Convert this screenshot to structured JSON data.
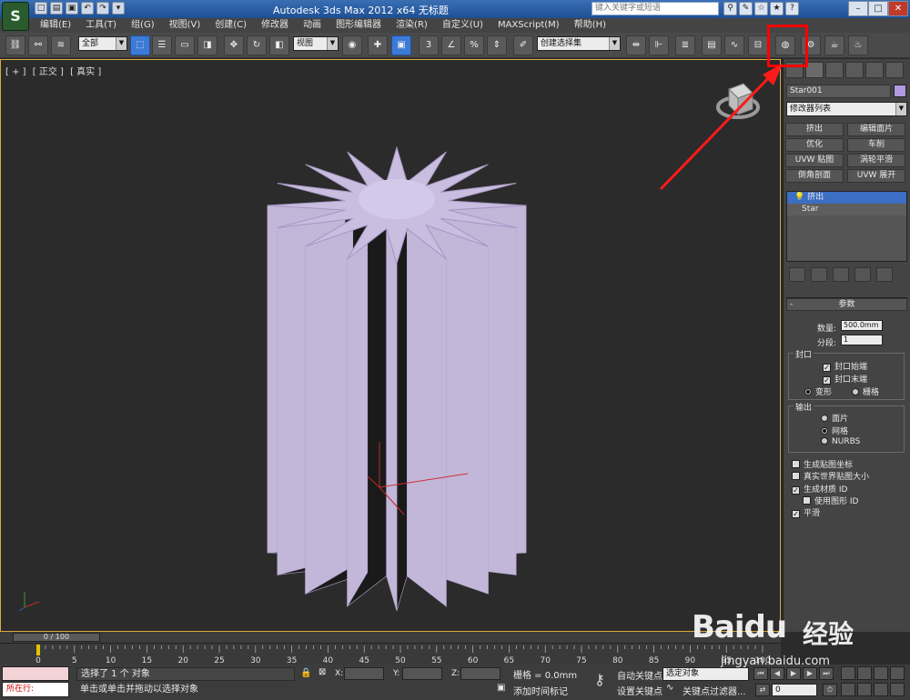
{
  "titlebar": {
    "app_logo": "S",
    "title": "Autodesk 3ds Max  2012 x64      无标题",
    "search_placeholder": "键入关键字或短语"
  },
  "menu": [
    "编辑(E)",
    "工具(T)",
    "组(G)",
    "视图(V)",
    "创建(C)",
    "修改器",
    "动画",
    "图形编辑器",
    "渲染(R)",
    "自定义(U)",
    "MAXScript(M)",
    "帮助(H)"
  ],
  "toolbar": {
    "filter_select": "全部",
    "view_select": "视图",
    "selection_set": "创建选择集",
    "icons": [
      "link-icon",
      "unlink-icon",
      "bind-icon",
      "select-icon",
      "select-by-name-icon",
      "rect-select-icon",
      "window-crossing-icon",
      "move-icon",
      "rotate-icon",
      "scale-icon",
      "pivot-icon",
      "manipulate-icon",
      "snap-3d-icon",
      "angle-snap-icon",
      "percent-snap-icon",
      "spinner-snap-icon",
      "edit-named-sel-icon",
      "mirror-icon",
      "align-icon",
      "layer-icon",
      "graphite-icon",
      "curve-editor-icon",
      "schematic-icon",
      "material-editor-icon",
      "render-setup-icon",
      "render-frame-icon",
      "render-icon"
    ]
  },
  "viewport": {
    "labels": [
      "[ + ]",
      "[ 正交 ]",
      "[ 真实 ]"
    ]
  },
  "command_panel": {
    "object_name": "Star001",
    "object_color": "#b29ae0",
    "modifier_list": "修改器列表",
    "modifier_buttons": [
      "挤出",
      "编辑面片",
      "优化",
      "车削",
      "UVW 贴图",
      "涡轮平滑",
      "倒角剖面",
      "UVW 展开"
    ],
    "stack": [
      {
        "label": "挤出",
        "selected": true
      },
      {
        "label": "Star",
        "selected": false
      }
    ],
    "params": {
      "title": "参数",
      "amount_label": "数量:",
      "amount_value": "500.0mm",
      "segments_label": "分段:",
      "segments_value": "1",
      "capping_title": "封口",
      "cap_start": "封口始端",
      "cap_end": "封口末端",
      "morph": "变形",
      "grid": "栅格",
      "output_title": "输出",
      "patch": "面片",
      "mesh": "网格",
      "nurbs": "NURBS",
      "gen_map_coords": "生成贴图坐标",
      "real_world_map": "真实世界贴图大小",
      "gen_mat_id": "生成材质 ID",
      "use_shape_id": "使用图形 ID",
      "smooth": "平滑"
    }
  },
  "timeline": {
    "slider": "0 / 100",
    "ticks": [
      "0",
      "5",
      "10",
      "15",
      "20",
      "25",
      "30",
      "35",
      "40",
      "45",
      "50",
      "55",
      "60",
      "65",
      "70",
      "75",
      "80",
      "85",
      "90",
      "95",
      "100"
    ]
  },
  "status": {
    "running": "所在行:",
    "selected_msg": "选择了 1 个 对象",
    "prompt": "单击或单击并拖动以选择对象",
    "x_label": "X:",
    "y_label": "Y:",
    "z_label": "Z:",
    "grid": "栅格 = 0.0mm",
    "add_time_tag": "添加时间标记",
    "auto_key": "自动关键点",
    "set_key": "设置关键点",
    "selected_object": "选定对象",
    "key_filters": "关键点过滤器...",
    "frame": "0"
  },
  "watermark": {
    "brand": "Baidu",
    "suffix": "经验",
    "url": "jingyan.baidu.com"
  }
}
